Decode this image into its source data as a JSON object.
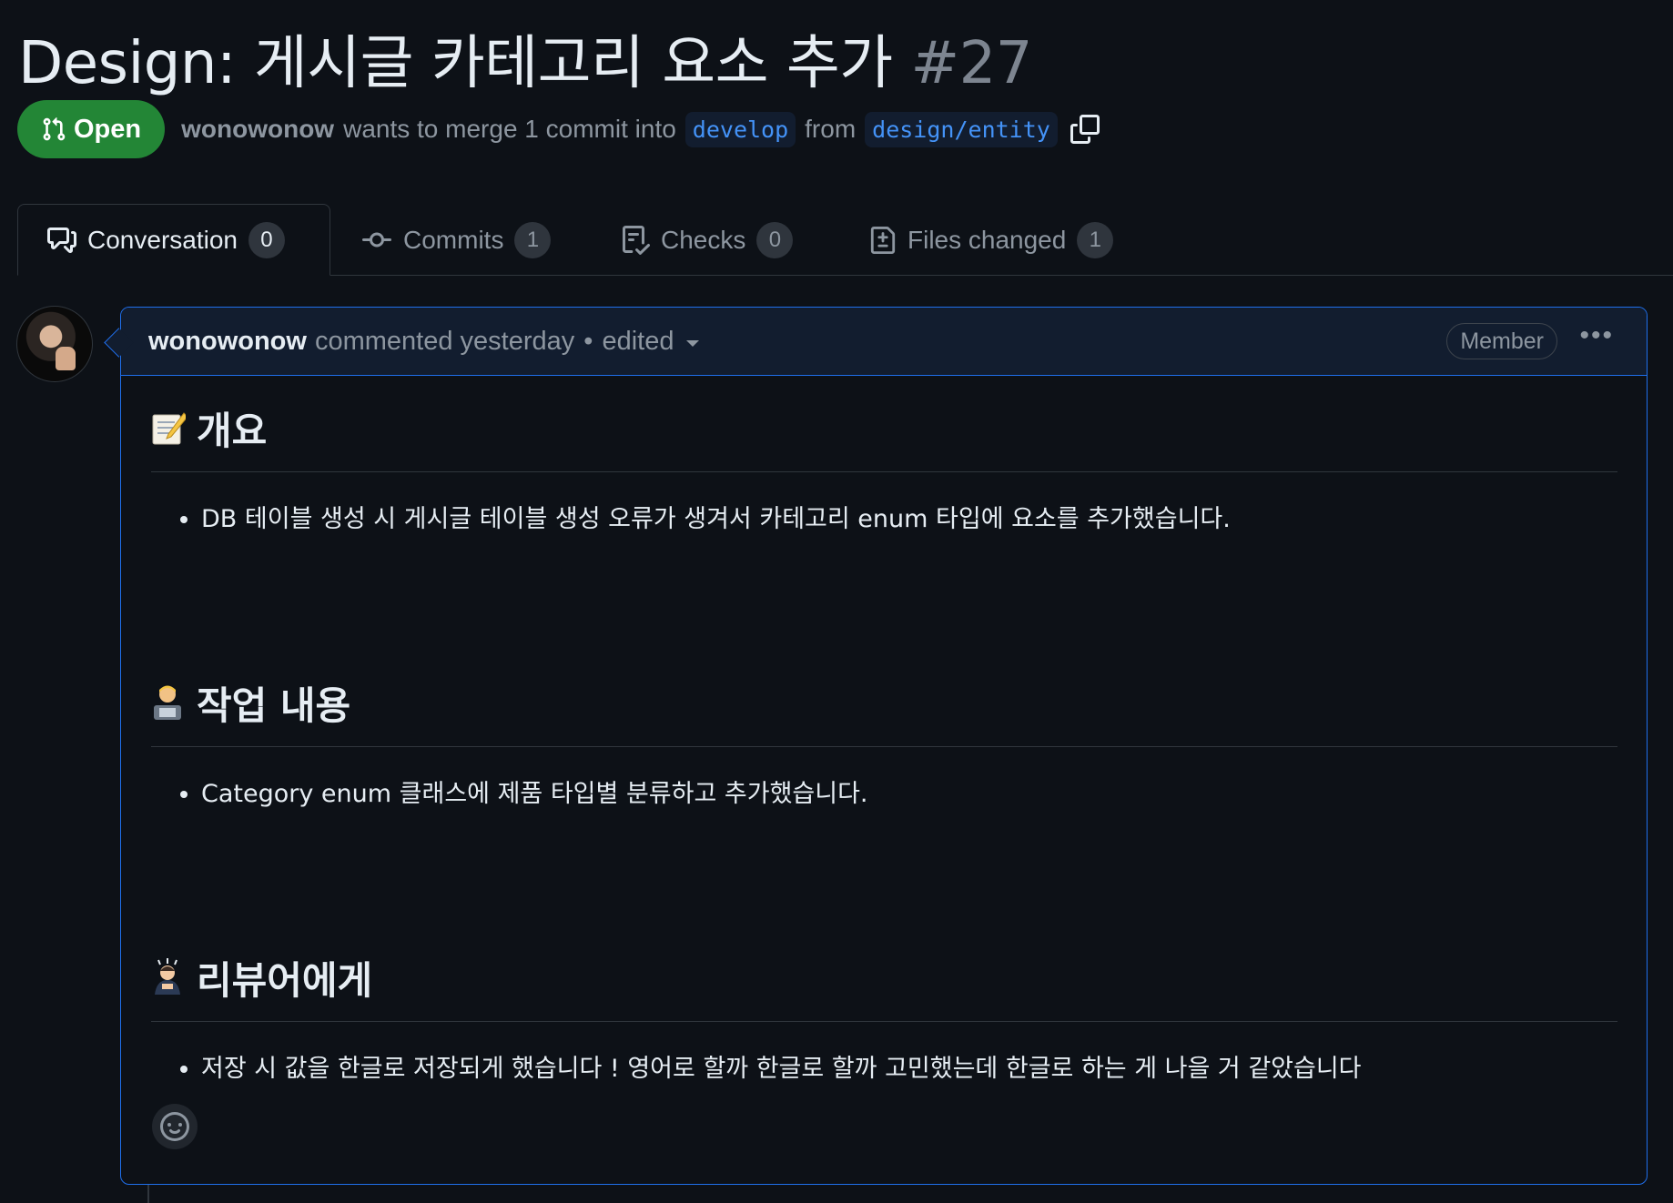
{
  "pr": {
    "title": "Design: 게시글 카테고리 요소 추가",
    "number": "#27",
    "state": "Open",
    "author": "wonowonow",
    "merge_text": "wants to merge 1 commit into",
    "base_branch": "develop",
    "from_text": "from",
    "head_branch": "design/entity"
  },
  "tabs": [
    {
      "label": "Conversation",
      "count": "0",
      "icon": "comment-discussion-icon"
    },
    {
      "label": "Commits",
      "count": "1",
      "icon": "git-commit-icon"
    },
    {
      "label": "Checks",
      "count": "0",
      "icon": "checklist-icon"
    },
    {
      "label": "Files changed",
      "count": "1",
      "icon": "file-diff-icon"
    }
  ],
  "comment": {
    "author": "wonowonow",
    "action": "commented yesterday",
    "separator": "•",
    "edited": "edited",
    "role": "Member",
    "sections": [
      {
        "heading": "개요",
        "emoji": "memo",
        "items": [
          "DB 테이블 생성 시 게시글 테이블 생성 오류가 생겨서 카테고리 enum 타입에 요소를 추가했습니다."
        ]
      },
      {
        "heading": "작업 내용",
        "emoji": "technologist",
        "items": [
          "Category enum 클래스에 제품 타입별 분류하고 추가했습니다."
        ]
      },
      {
        "heading": "리뷰어에게",
        "emoji": "person-bowing",
        "items": [
          "저장 시 값을 한글로 저장되게 했습니다 ! 영어로 할까 한글로 할까 고민했는데 한글로 하는 게 나을 거 같았습니다"
        ]
      }
    ]
  },
  "colors": {
    "background": "#0d1117",
    "open_badge": "#238636",
    "accent_border": "#1f6feb",
    "branch_text": "#4493f8",
    "muted": "#8d96a0"
  }
}
